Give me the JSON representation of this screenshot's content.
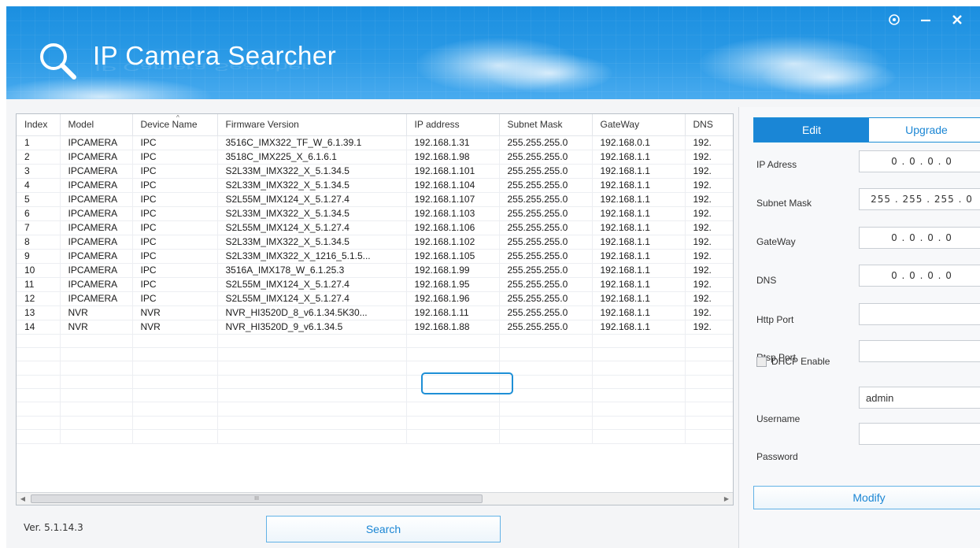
{
  "app": {
    "title": "IP Camera Searcher"
  },
  "window_controls": {
    "settings_icon": "circle-gear-icon",
    "minimize_icon": "minimize-icon",
    "close_icon": "close-icon"
  },
  "table": {
    "columns": [
      "Index",
      "Model",
      "Device Name",
      "Firmware Version",
      "IP address",
      "Subnet Mask",
      "GateWay",
      "DNS"
    ],
    "rows": [
      [
        "1",
        "IPCAMERA",
        "IPC",
        "3516C_IMX322_TF_W_6.1.39.1",
        "192.168.1.31",
        "255.255.255.0",
        "192.168.0.1",
        "192."
      ],
      [
        "2",
        "IPCAMERA",
        "IPC",
        "3518C_IMX225_X_6.1.6.1",
        "192.168.1.98",
        "255.255.255.0",
        "192.168.1.1",
        "192."
      ],
      [
        "3",
        "IPCAMERA",
        "IPC",
        "S2L33M_IMX322_X_5.1.34.5",
        "192.168.1.101",
        "255.255.255.0",
        "192.168.1.1",
        "192."
      ],
      [
        "4",
        "IPCAMERA",
        "IPC",
        "S2L33M_IMX322_X_5.1.34.5",
        "192.168.1.104",
        "255.255.255.0",
        "192.168.1.1",
        "192."
      ],
      [
        "5",
        "IPCAMERA",
        "IPC",
        "S2L55M_IMX124_X_5.1.27.4",
        "192.168.1.107",
        "255.255.255.0",
        "192.168.1.1",
        "192."
      ],
      [
        "6",
        "IPCAMERA",
        "IPC",
        "S2L33M_IMX322_X_5.1.34.5",
        "192.168.1.103",
        "255.255.255.0",
        "192.168.1.1",
        "192."
      ],
      [
        "7",
        "IPCAMERA",
        "IPC",
        "S2L55M_IMX124_X_5.1.27.4",
        "192.168.1.106",
        "255.255.255.0",
        "192.168.1.1",
        "192."
      ],
      [
        "8",
        "IPCAMERA",
        "IPC",
        "S2L33M_IMX322_X_5.1.34.5",
        "192.168.1.102",
        "255.255.255.0",
        "192.168.1.1",
        "192."
      ],
      [
        "9",
        "IPCAMERA",
        "IPC",
        "S2L33M_IMX322_X_1216_5.1.5...",
        "192.168.1.105",
        "255.255.255.0",
        "192.168.1.1",
        "192."
      ],
      [
        "10",
        "IPCAMERA",
        "IPC",
        "3516A_IMX178_W_6.1.25.3",
        "192.168.1.99",
        "255.255.255.0",
        "192.168.1.1",
        "192."
      ],
      [
        "11",
        "IPCAMERA",
        "IPC",
        "S2L55M_IMX124_X_5.1.27.4",
        "192.168.1.95",
        "255.255.255.0",
        "192.168.1.1",
        "192."
      ],
      [
        "12",
        "IPCAMERA",
        "IPC",
        "S2L55M_IMX124_X_5.1.27.4",
        "192.168.1.96",
        "255.255.255.0",
        "192.168.1.1",
        "192."
      ],
      [
        "13",
        "NVR",
        "NVR",
        "NVR_HI3520D_8_v6.1.34.5K30...",
        "192.168.1.11",
        "255.255.255.0",
        "192.168.1.1",
        "192."
      ],
      [
        "14",
        "NVR",
        "NVR",
        "NVR_HI3520D_9_v6.1.34.5",
        "192.168.1.88",
        "255.255.255.0",
        "192.168.1.1",
        "192."
      ]
    ],
    "empty_rows": 8,
    "highlight_color": "#1e8fd6",
    "scroll_thumb_grip": "III"
  },
  "footer": {
    "version": "Ver. 5.1.14.3",
    "search_label": "Search"
  },
  "panel": {
    "tabs": {
      "edit": "Edit",
      "upgrade": "Upgrade"
    },
    "fields": {
      "ip_label": "IP Adress",
      "ip_value": "0  .  0  .  0  .  0",
      "subnet_label": "Subnet Mask",
      "subnet_value": "255 . 255 . 255 .  0",
      "gateway_label": "GateWay",
      "gateway_value": "0  .  0  .  0  .  0",
      "dns_label": "DNS",
      "dns_value": "0  .  0  .  0  .  0",
      "http_label": "Http Port",
      "http_value": "",
      "rtsp_label": "Rtsp Port",
      "rtsp_value": "",
      "dhcp_label": "DHCP Enable",
      "username_label": "Username",
      "username_value": "admin",
      "password_label": "Password",
      "password_value": ""
    },
    "modify_label": "Modify"
  },
  "colors": {
    "header_blue": "#2b9ae6",
    "accent": "#1a86d6"
  }
}
